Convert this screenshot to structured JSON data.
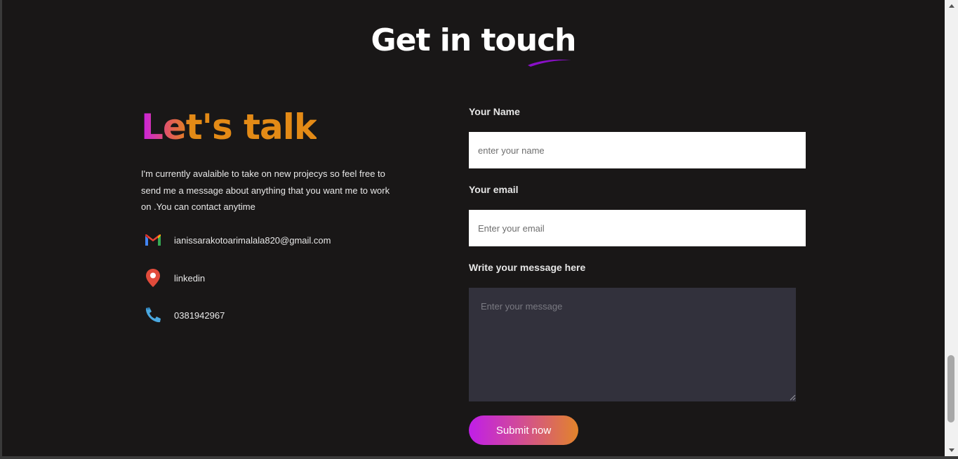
{
  "section": {
    "title": "Get in touch"
  },
  "left": {
    "heading": "Let's talk",
    "intro": "I'm currently avalaible to take on new projecys so feel free to send me a message about anything that you want me to work on .You can contact anytime",
    "contacts": [
      {
        "icon": "gmail-icon",
        "text": "ianissarakotoarimalala820@gmail.com"
      },
      {
        "icon": "location-pin-icon",
        "text": "linkedin"
      },
      {
        "icon": "phone-icon",
        "text": "0381942967"
      }
    ]
  },
  "form": {
    "name_label": "Your Name",
    "name_placeholder": "enter your name",
    "email_label": "Your email",
    "email_placeholder": "Enter your email",
    "message_label": "Write your message here",
    "message_placeholder": "Enter your message",
    "submit_label": "Submit now"
  },
  "colors": {
    "background": "#191717",
    "accent_purple": "#c01ee8",
    "accent_orange": "#e38a16",
    "message_bg": "#32313c"
  },
  "scroll": {
    "position": 0.94
  }
}
